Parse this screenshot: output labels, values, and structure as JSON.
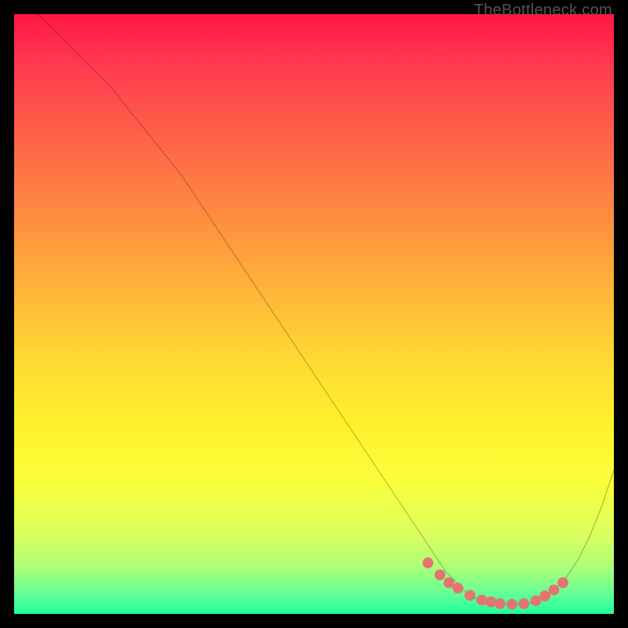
{
  "watermark_text": "TheBottleneck.com",
  "chart_data": {
    "type": "line",
    "title": "",
    "xlabel": "",
    "ylabel": "",
    "xlim": [
      0,
      100
    ],
    "ylim": [
      0,
      100
    ],
    "series": [
      {
        "name": "curve",
        "x": [
          4,
          8,
          12,
          16,
          20,
          24,
          28,
          32,
          36,
          40,
          44,
          48,
          52,
          56,
          60,
          64,
          68,
          70,
          72,
          74,
          76,
          78,
          80,
          82,
          84,
          86,
          88,
          90,
          92,
          94,
          96,
          98,
          100
        ],
        "y": [
          100,
          96,
          92,
          88,
          83,
          78,
          73,
          67,
          61,
          55,
          49,
          43,
          37,
          31,
          25,
          19,
          13,
          10,
          7,
          5,
          3,
          2.2,
          1.8,
          1.6,
          1.6,
          1.8,
          2.4,
          4,
          6,
          9,
          13,
          18,
          24
        ]
      }
    ],
    "markers": {
      "name": "highlight-dots",
      "color": "#e57373",
      "x": [
        69,
        71,
        72.5,
        74,
        76,
        78,
        79.5,
        81,
        83,
        85,
        87,
        88.5,
        90,
        91.5
      ],
      "y": [
        8.5,
        6.5,
        5.2,
        4.3,
        3.1,
        2.3,
        2.0,
        1.7,
        1.6,
        1.7,
        2.2,
        3.0,
        4.0,
        5.2
      ]
    },
    "gradient_stops": [
      {
        "offset": 0,
        "color": "#ff1744"
      },
      {
        "offset": 8,
        "color": "#ff3850"
      },
      {
        "offset": 18,
        "color": "#ff5a4a"
      },
      {
        "offset": 28,
        "color": "#ff7a44"
      },
      {
        "offset": 38,
        "color": "#ff9a3e"
      },
      {
        "offset": 48,
        "color": "#ffba38"
      },
      {
        "offset": 58,
        "color": "#ffda32"
      },
      {
        "offset": 68,
        "color": "#fff02c"
      },
      {
        "offset": 78,
        "color": "#faff3c"
      },
      {
        "offset": 86,
        "color": "#e0ff5a"
      },
      {
        "offset": 92,
        "color": "#b0ff78"
      },
      {
        "offset": 96,
        "color": "#70ff90"
      },
      {
        "offset": 100,
        "color": "#20ffa0"
      }
    ]
  }
}
